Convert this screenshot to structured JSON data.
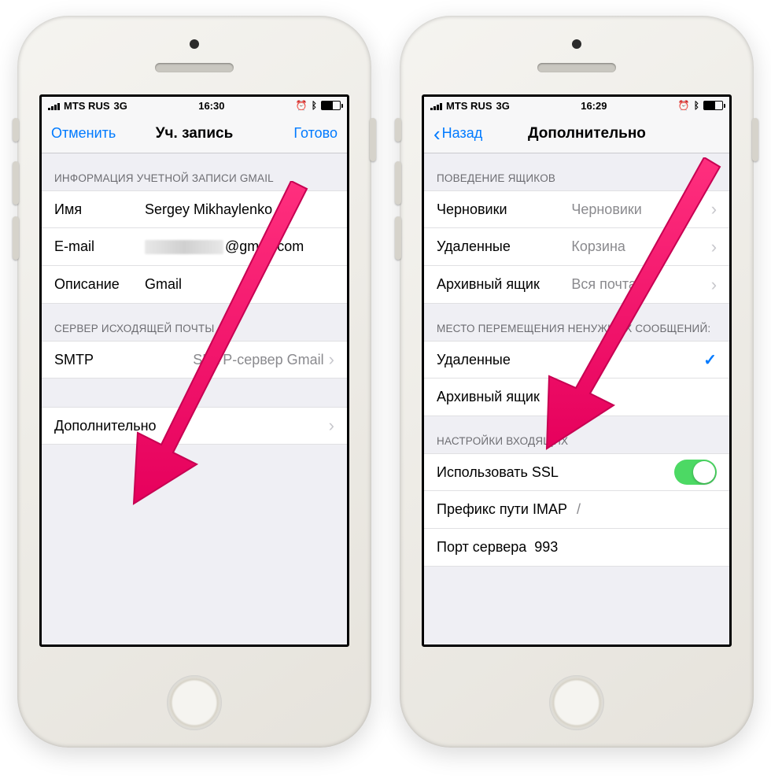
{
  "status": {
    "carrier": "MTS RUS",
    "net": "3G",
    "timeLeft": "16:30",
    "timeRight": "16:29"
  },
  "left": {
    "nav": {
      "cancel": "Отменить",
      "title": "Уч. запись",
      "done": "Готово"
    },
    "sectionAccount": "ИНФОРМАЦИЯ УЧЕТНОЙ ЗАПИСИ GMAIL",
    "name": {
      "label": "Имя",
      "value": "Sergey Mikhaylenko"
    },
    "email": {
      "label": "E-mail",
      "suffix": "@gmail.com"
    },
    "description": {
      "label": "Описание",
      "value": "Gmail"
    },
    "sectionSmtp": "СЕРВЕР ИСХОДЯЩЕЙ ПОЧТЫ",
    "smtp": {
      "label": "SMTP",
      "value": "SMTP-сервер Gmail"
    },
    "advanced": "Дополнительно"
  },
  "right": {
    "nav": {
      "back": "Назад",
      "title": "Дополнительно"
    },
    "sectionBoxes": "ПОВЕДЕНИЕ ЯЩИКОВ",
    "drafts": {
      "label": "Черновики",
      "value": "Черновики"
    },
    "deleted": {
      "label": "Удаленные",
      "value": "Корзина"
    },
    "archive": {
      "label": "Архивный ящик",
      "value": "Вся почта"
    },
    "sectionMove": "МЕСТО ПЕРЕМЕЩЕНИЯ НЕНУЖНЫХ СООБЩЕНИЙ:",
    "moveDeleted": "Удаленные",
    "moveArchive": "Архивный ящик",
    "sectionIncoming": "НАСТРОЙКИ ВХОДЯЩИХ",
    "ssl": "Использовать SSL",
    "imap": {
      "label": "Префикс пути IMAP",
      "value": "/"
    },
    "port": {
      "label": "Порт сервера",
      "value": "993"
    }
  }
}
